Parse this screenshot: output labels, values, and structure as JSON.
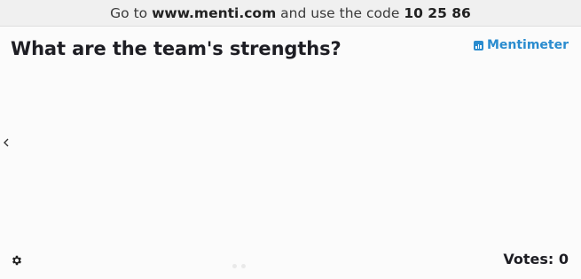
{
  "banner": {
    "prefix": "Go to",
    "url": "www.menti.com",
    "middle": "and use the code",
    "code": "10 25 86"
  },
  "question": {
    "title": "What are the team's strengths?"
  },
  "brand": {
    "name": "Mentimeter",
    "color": "#2a8ccf"
  },
  "footer": {
    "votes_label": "Votes: 0"
  },
  "icons": {
    "prev": "chevron-left-icon",
    "settings": "gear-icon",
    "logo": "mentimeter-logo-icon"
  }
}
